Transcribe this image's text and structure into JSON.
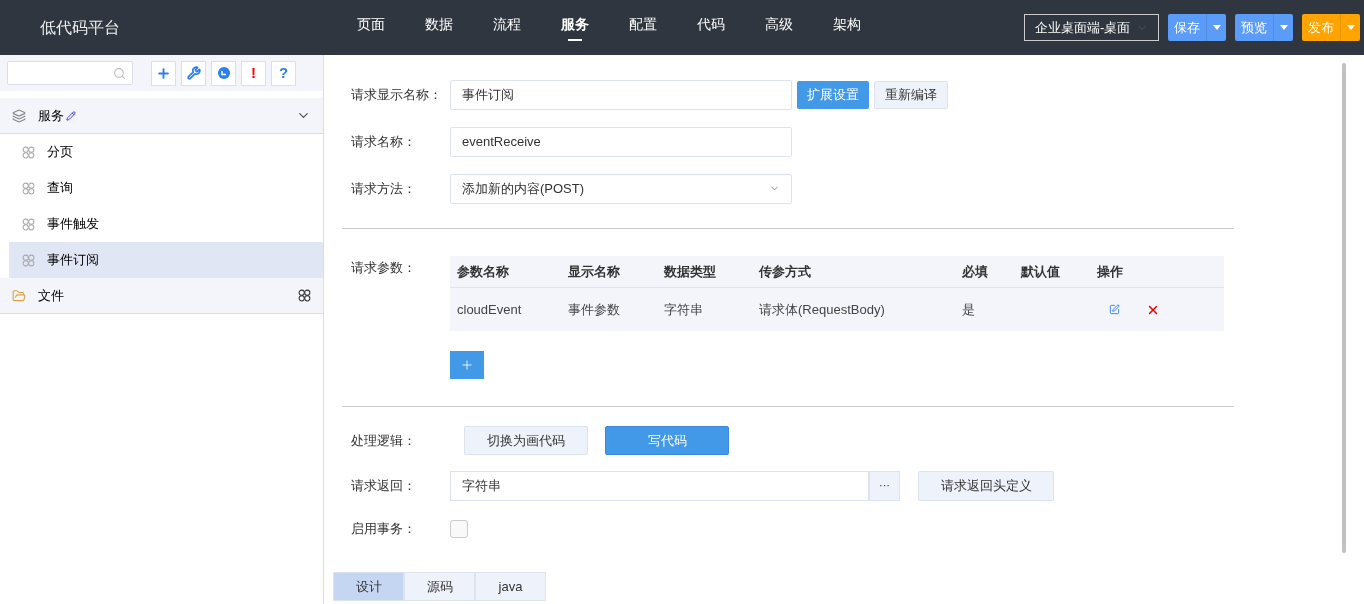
{
  "app": {
    "title": "低代码平台"
  },
  "nav": [
    {
      "label": "页面",
      "selected": false
    },
    {
      "label": "数据",
      "selected": false
    },
    {
      "label": "流程",
      "selected": false
    },
    {
      "label": "服务",
      "selected": true
    },
    {
      "label": "配置",
      "selected": false
    },
    {
      "label": "代码",
      "selected": false
    },
    {
      "label": "高级",
      "selected": false
    },
    {
      "label": "架构",
      "selected": false
    }
  ],
  "header_actions": {
    "environment": "企业桌面端-桌面",
    "buttons": [
      {
        "label": "保存",
        "color": "#5b9cf8"
      },
      {
        "label": "预览",
        "color": "#5b9cf8"
      },
      {
        "label": "发布",
        "color": "#ffa400"
      }
    ]
  },
  "sidebar": {
    "toolbar_marks": [
      "!",
      "?"
    ],
    "groups": [
      {
        "label": "服务",
        "kind": "service",
        "expanded": true,
        "children": [
          {
            "label": "分页",
            "selected": false
          },
          {
            "label": "查询",
            "selected": false
          },
          {
            "label": "事件触发",
            "selected": false
          },
          {
            "label": "事件订阅",
            "selected": true
          }
        ]
      },
      {
        "label": "文件",
        "kind": "folder",
        "expanded": false
      }
    ]
  },
  "form": {
    "display_name": {
      "label": "请求显示名称：",
      "value": "事件订阅",
      "buttons": [
        {
          "label": "扩展设置",
          "primary": true
        },
        {
          "label": "重新编译",
          "primary": false
        }
      ]
    },
    "name": {
      "label": "请求名称：",
      "value": "eventReceive"
    },
    "method": {
      "label": "请求方法：",
      "value": "添加新的内容(POST)"
    },
    "params": {
      "label": "请求参数：",
      "columns": [
        "参数名称",
        "显示名称",
        "数据类型",
        "传参方式",
        "必填",
        "默认值",
        "操作"
      ],
      "rows": [
        {
          "cells": [
            "cloudEvent",
            "事件参数",
            "字符串",
            "请求体(RequestBody)",
            "是",
            ""
          ]
        }
      ]
    },
    "logic": {
      "label": "处理逻辑：",
      "options": [
        {
          "label": "切换为画代码",
          "selected": false
        },
        {
          "label": "写代码",
          "selected": true
        }
      ]
    },
    "response": {
      "label": "请求返回：",
      "value": "字符串",
      "more": "···",
      "header_button": "请求返回头定义"
    },
    "transaction": {
      "label": "启用事务：",
      "checked": false
    }
  },
  "bottom_tabs": [
    {
      "label": "设计",
      "selected": true
    },
    {
      "label": "源码",
      "selected": false
    },
    {
      "label": "java",
      "selected": false
    }
  ]
}
